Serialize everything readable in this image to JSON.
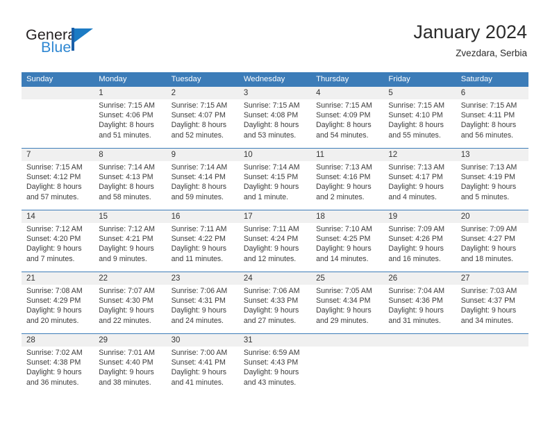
{
  "brand": {
    "name_dark": "General",
    "name_blue": "Blue",
    "mark": "triangle-logo"
  },
  "header": {
    "title": "January 2024",
    "subtitle": "Zvezdara, Serbia"
  },
  "colors": {
    "header_blue": "#3c7cb8",
    "row_band": "#f0f0f0",
    "brand_blue": "#2e87d2",
    "text": "#3a3a3a"
  },
  "weekdays": [
    "Sunday",
    "Monday",
    "Tuesday",
    "Wednesday",
    "Thursday",
    "Friday",
    "Saturday"
  ],
  "weeks": [
    {
      "numbers": [
        "",
        "1",
        "2",
        "3",
        "4",
        "5",
        "6"
      ],
      "cells": [
        {
          "lines": []
        },
        {
          "lines": [
            "Sunrise: 7:15 AM",
            "Sunset: 4:06 PM",
            "Daylight: 8 hours",
            "and 51 minutes."
          ]
        },
        {
          "lines": [
            "Sunrise: 7:15 AM",
            "Sunset: 4:07 PM",
            "Daylight: 8 hours",
            "and 52 minutes."
          ]
        },
        {
          "lines": [
            "Sunrise: 7:15 AM",
            "Sunset: 4:08 PM",
            "Daylight: 8 hours",
            "and 53 minutes."
          ]
        },
        {
          "lines": [
            "Sunrise: 7:15 AM",
            "Sunset: 4:09 PM",
            "Daylight: 8 hours",
            "and 54 minutes."
          ]
        },
        {
          "lines": [
            "Sunrise: 7:15 AM",
            "Sunset: 4:10 PM",
            "Daylight: 8 hours",
            "and 55 minutes."
          ]
        },
        {
          "lines": [
            "Sunrise: 7:15 AM",
            "Sunset: 4:11 PM",
            "Daylight: 8 hours",
            "and 56 minutes."
          ]
        }
      ]
    },
    {
      "numbers": [
        "7",
        "8",
        "9",
        "10",
        "11",
        "12",
        "13"
      ],
      "cells": [
        {
          "lines": [
            "Sunrise: 7:15 AM",
            "Sunset: 4:12 PM",
            "Daylight: 8 hours",
            "and 57 minutes."
          ]
        },
        {
          "lines": [
            "Sunrise: 7:14 AM",
            "Sunset: 4:13 PM",
            "Daylight: 8 hours",
            "and 58 minutes."
          ]
        },
        {
          "lines": [
            "Sunrise: 7:14 AM",
            "Sunset: 4:14 PM",
            "Daylight: 8 hours",
            "and 59 minutes."
          ]
        },
        {
          "lines": [
            "Sunrise: 7:14 AM",
            "Sunset: 4:15 PM",
            "Daylight: 9 hours",
            "and 1 minute."
          ]
        },
        {
          "lines": [
            "Sunrise: 7:13 AM",
            "Sunset: 4:16 PM",
            "Daylight: 9 hours",
            "and 2 minutes."
          ]
        },
        {
          "lines": [
            "Sunrise: 7:13 AM",
            "Sunset: 4:17 PM",
            "Daylight: 9 hours",
            "and 4 minutes."
          ]
        },
        {
          "lines": [
            "Sunrise: 7:13 AM",
            "Sunset: 4:19 PM",
            "Daylight: 9 hours",
            "and 5 minutes."
          ]
        }
      ]
    },
    {
      "numbers": [
        "14",
        "15",
        "16",
        "17",
        "18",
        "19",
        "20"
      ],
      "cells": [
        {
          "lines": [
            "Sunrise: 7:12 AM",
            "Sunset: 4:20 PM",
            "Daylight: 9 hours",
            "and 7 minutes."
          ]
        },
        {
          "lines": [
            "Sunrise: 7:12 AM",
            "Sunset: 4:21 PM",
            "Daylight: 9 hours",
            "and 9 minutes."
          ]
        },
        {
          "lines": [
            "Sunrise: 7:11 AM",
            "Sunset: 4:22 PM",
            "Daylight: 9 hours",
            "and 11 minutes."
          ]
        },
        {
          "lines": [
            "Sunrise: 7:11 AM",
            "Sunset: 4:24 PM",
            "Daylight: 9 hours",
            "and 12 minutes."
          ]
        },
        {
          "lines": [
            "Sunrise: 7:10 AM",
            "Sunset: 4:25 PM",
            "Daylight: 9 hours",
            "and 14 minutes."
          ]
        },
        {
          "lines": [
            "Sunrise: 7:09 AM",
            "Sunset: 4:26 PM",
            "Daylight: 9 hours",
            "and 16 minutes."
          ]
        },
        {
          "lines": [
            "Sunrise: 7:09 AM",
            "Sunset: 4:27 PM",
            "Daylight: 9 hours",
            "and 18 minutes."
          ]
        }
      ]
    },
    {
      "numbers": [
        "21",
        "22",
        "23",
        "24",
        "25",
        "26",
        "27"
      ],
      "cells": [
        {
          "lines": [
            "Sunrise: 7:08 AM",
            "Sunset: 4:29 PM",
            "Daylight: 9 hours",
            "and 20 minutes."
          ]
        },
        {
          "lines": [
            "Sunrise: 7:07 AM",
            "Sunset: 4:30 PM",
            "Daylight: 9 hours",
            "and 22 minutes."
          ]
        },
        {
          "lines": [
            "Sunrise: 7:06 AM",
            "Sunset: 4:31 PM",
            "Daylight: 9 hours",
            "and 24 minutes."
          ]
        },
        {
          "lines": [
            "Sunrise: 7:06 AM",
            "Sunset: 4:33 PM",
            "Daylight: 9 hours",
            "and 27 minutes."
          ]
        },
        {
          "lines": [
            "Sunrise: 7:05 AM",
            "Sunset: 4:34 PM",
            "Daylight: 9 hours",
            "and 29 minutes."
          ]
        },
        {
          "lines": [
            "Sunrise: 7:04 AM",
            "Sunset: 4:36 PM",
            "Daylight: 9 hours",
            "and 31 minutes."
          ]
        },
        {
          "lines": [
            "Sunrise: 7:03 AM",
            "Sunset: 4:37 PM",
            "Daylight: 9 hours",
            "and 34 minutes."
          ]
        }
      ]
    },
    {
      "numbers": [
        "28",
        "29",
        "30",
        "31",
        "",
        "",
        ""
      ],
      "cells": [
        {
          "lines": [
            "Sunrise: 7:02 AM",
            "Sunset: 4:38 PM",
            "Daylight: 9 hours",
            "and 36 minutes."
          ]
        },
        {
          "lines": [
            "Sunrise: 7:01 AM",
            "Sunset: 4:40 PM",
            "Daylight: 9 hours",
            "and 38 minutes."
          ]
        },
        {
          "lines": [
            "Sunrise: 7:00 AM",
            "Sunset: 4:41 PM",
            "Daylight: 9 hours",
            "and 41 minutes."
          ]
        },
        {
          "lines": [
            "Sunrise: 6:59 AM",
            "Sunset: 4:43 PM",
            "Daylight: 9 hours",
            "and 43 minutes."
          ]
        },
        {
          "lines": []
        },
        {
          "lines": []
        },
        {
          "lines": []
        }
      ]
    }
  ]
}
